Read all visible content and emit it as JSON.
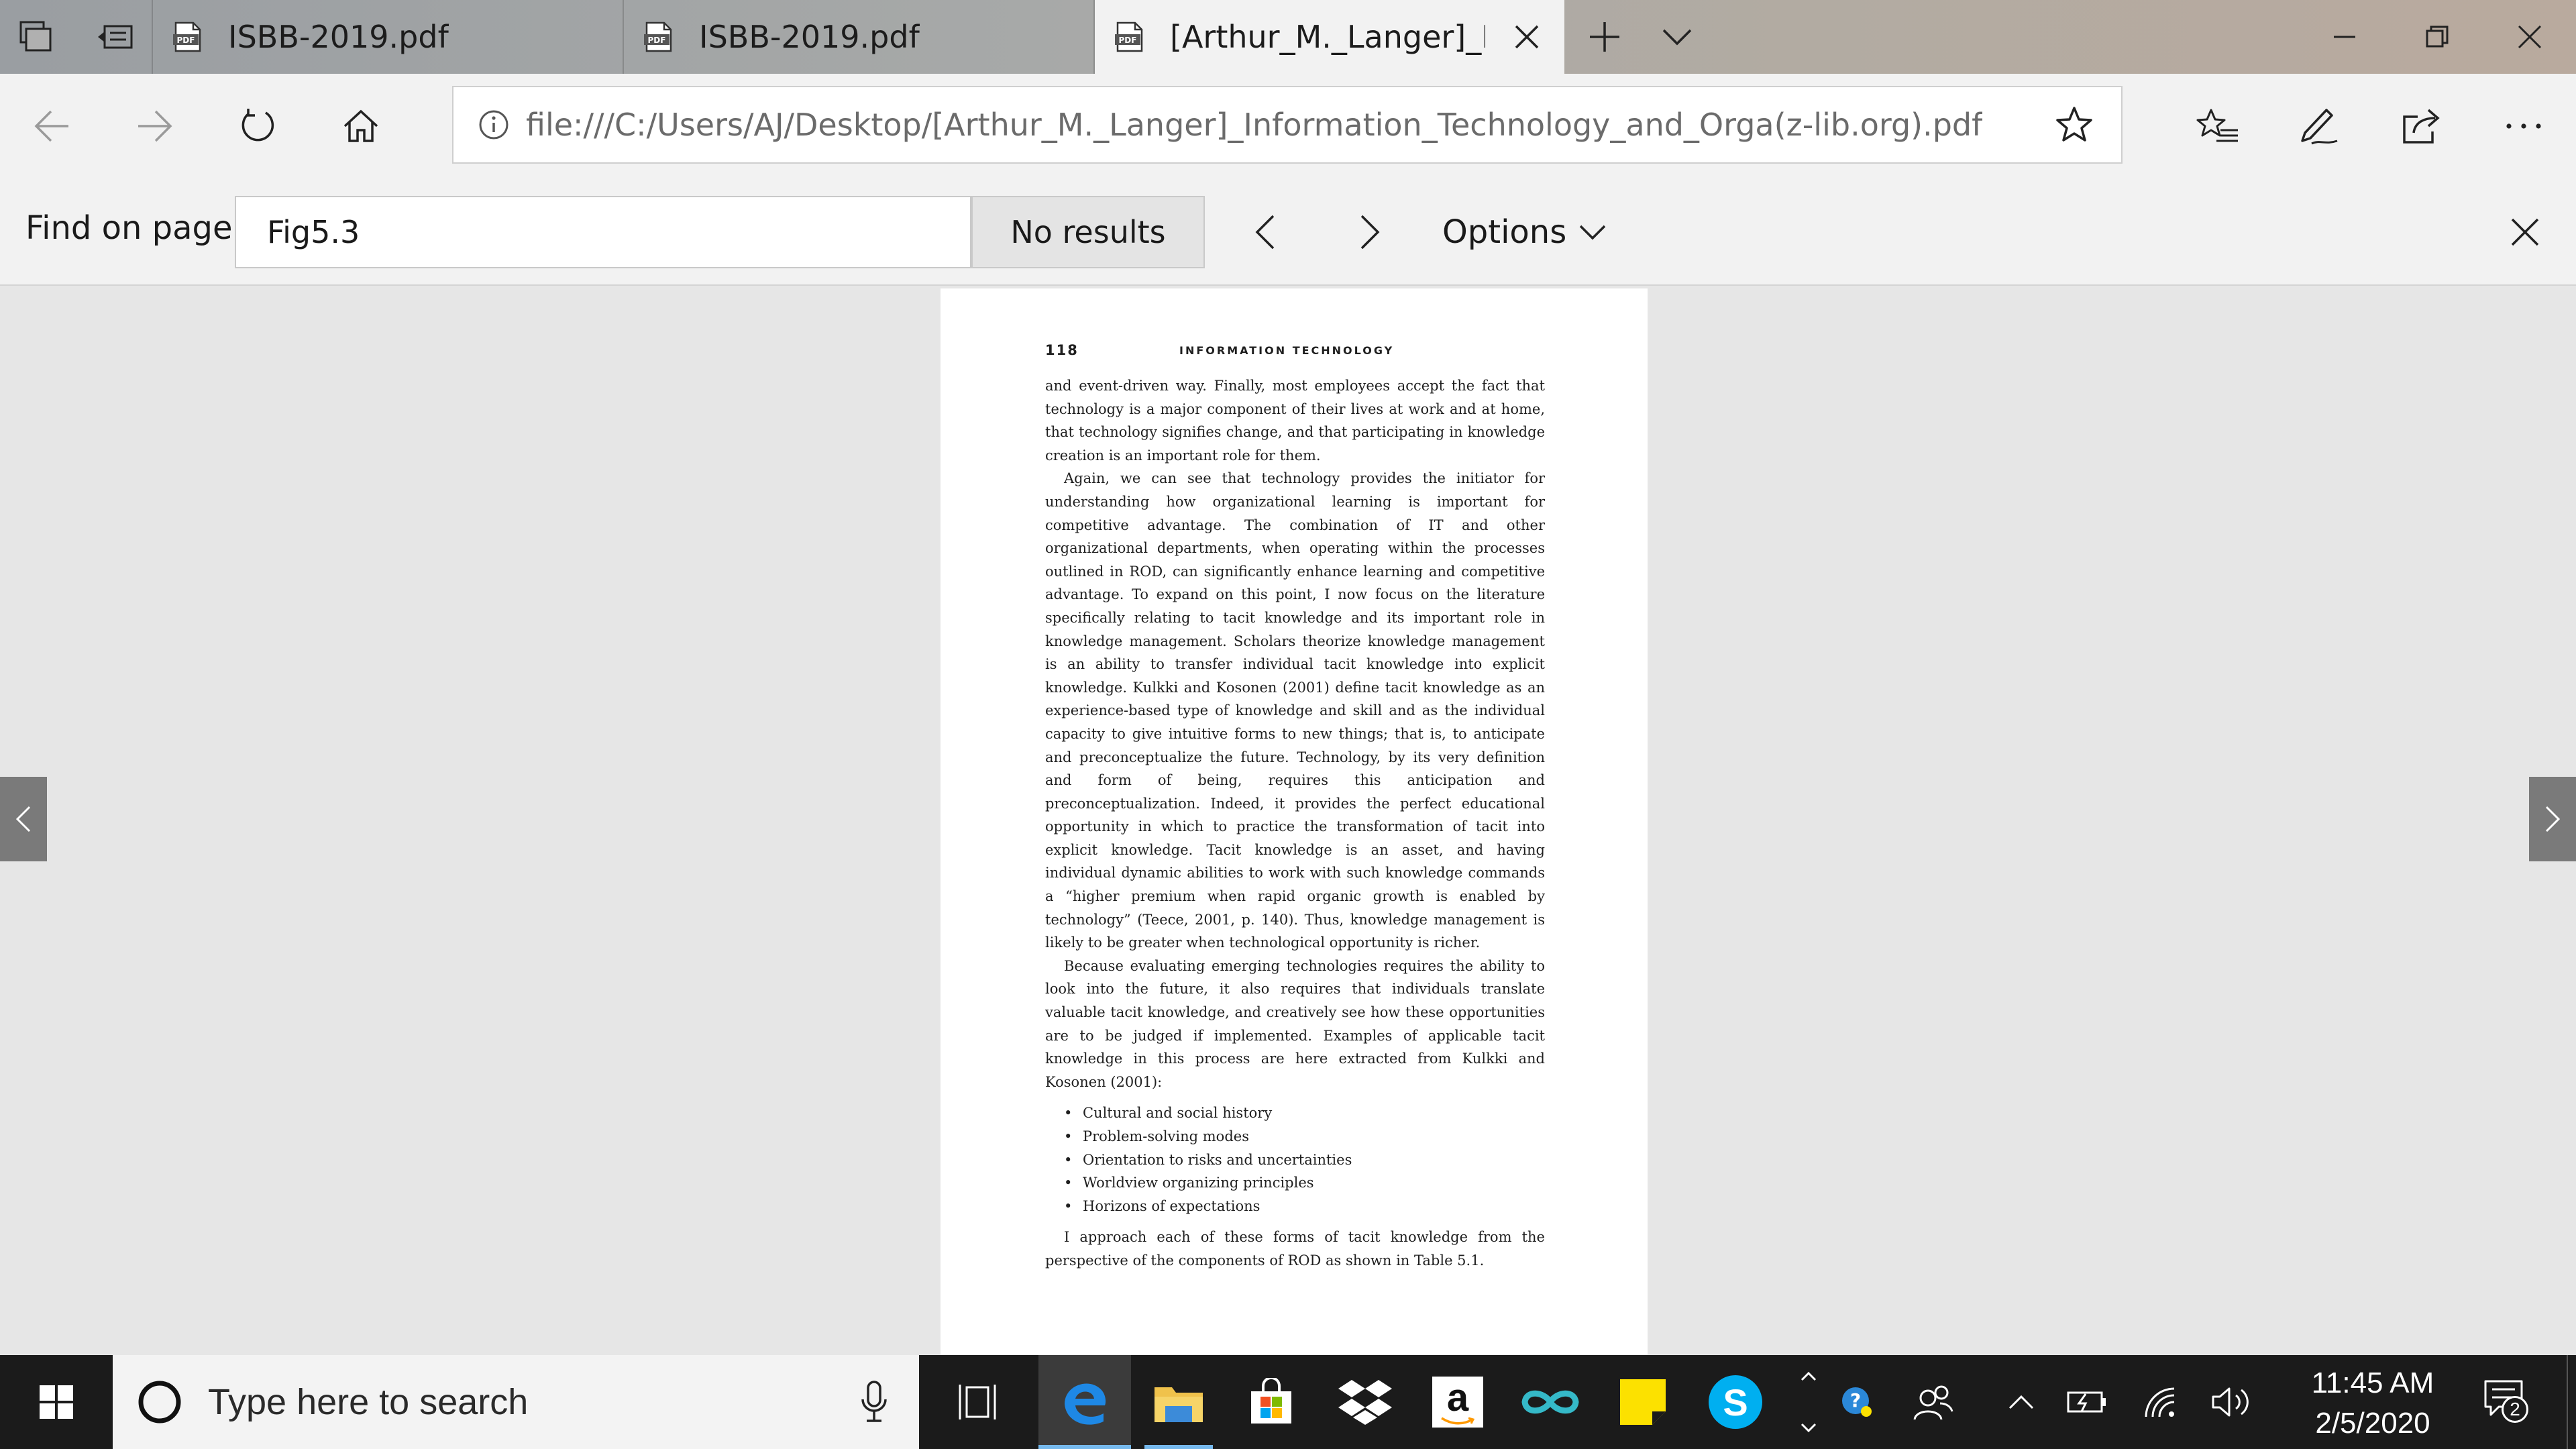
{
  "browser": {
    "tabs": [
      {
        "title": "ISBB-2019.pdf",
        "icon": "pdf-icon",
        "active": false
      },
      {
        "title": "ISBB-2019.pdf",
        "icon": "pdf-icon",
        "active": false
      },
      {
        "title": "[Arthur_M._Langer]_Infc",
        "icon": "pdf-icon",
        "active": true
      }
    ],
    "address": {
      "url": "file:///C:/Users/AJ/Desktop/[Arthur_M._Langer]_Information_Technology_and_Orga(z-lib.org).pdf"
    }
  },
  "find_bar": {
    "label": "Find on page",
    "query": "Fig5.3",
    "results": "No results",
    "options_label": "Options"
  },
  "document": {
    "page_number": "118",
    "running_head": "INFORMATION TECHNOLOGY",
    "paragraphs": [
      "and event-driven way. Finally, most employees accept the fact that technology is a major component of their lives at work and at home, that technology signifies change, and that participating in knowledge creation is an important role for them.",
      "Again, we can see that technology provides the initiator for understanding how organizational learning is important for competitive advantage. The combination of IT and other organizational departments, when operating within the processes outlined in ROD, can significantly enhance learning and competitive advantage. To expand on this point, I now focus on the literature specifically relating to tacit knowledge and its important role in knowledge management. Scholars theorize knowledge management is an ability to transfer individual tacit knowledge into explicit knowledge. Kulkki and Kosonen (2001) define tacit knowledge as an experience-based type of knowledge and skill and as the individual capacity to give intuitive forms to new things; that is, to anticipate and preconceptualize the future. Technology, by its very definition and form of being, requires this anticipation and preconceptualization. Indeed, it provides the perfect educational opportunity in which to practice the transformation of tacit into explicit knowledge. Tacit knowledge is an asset, and having individual dynamic abilities to work with such knowledge commands a “higher premium when rapid organic growth is enabled by technology” (Teece, 2001, p. 140). Thus, knowledge management is likely to be greater when technological opportunity is richer.",
      "Because evaluating emerging technologies requires the ability to look into the future, it also requires that individuals translate valuable tacit knowledge, and creatively see how these opportunities are to be judged if implemented. Examples of applicable tacit knowledge in this process are here extracted from Kulkki and Kosonen (2001):"
    ],
    "bullets": [
      "Cultural and social history",
      "Problem-solving modes",
      "Orientation to risks and uncertainties",
      "Worldview organizing principles",
      "Horizons of expectations"
    ],
    "closing_paragraph": "I approach each of these forms of tacit knowledge from the perspective of the components of ROD as shown in Table 5.1."
  },
  "taskbar": {
    "search_placeholder": "Type here to search",
    "apps": [
      "task-view",
      "edge",
      "file-explorer",
      "microsoft-store",
      "dropbox",
      "amazon",
      "infinity-app",
      "sticky-notes",
      "skype"
    ],
    "amazon_glyph": "a",
    "skype_glyph": "S",
    "clock": {
      "time": "11:45 AM",
      "date": "2/5/2020"
    },
    "notifications_count": "2"
  },
  "colors": {
    "accent": "#76b9ed",
    "edge_blue": "#1e88e5",
    "skype_blue": "#00aff0",
    "sticky_yellow": "#fce100"
  }
}
